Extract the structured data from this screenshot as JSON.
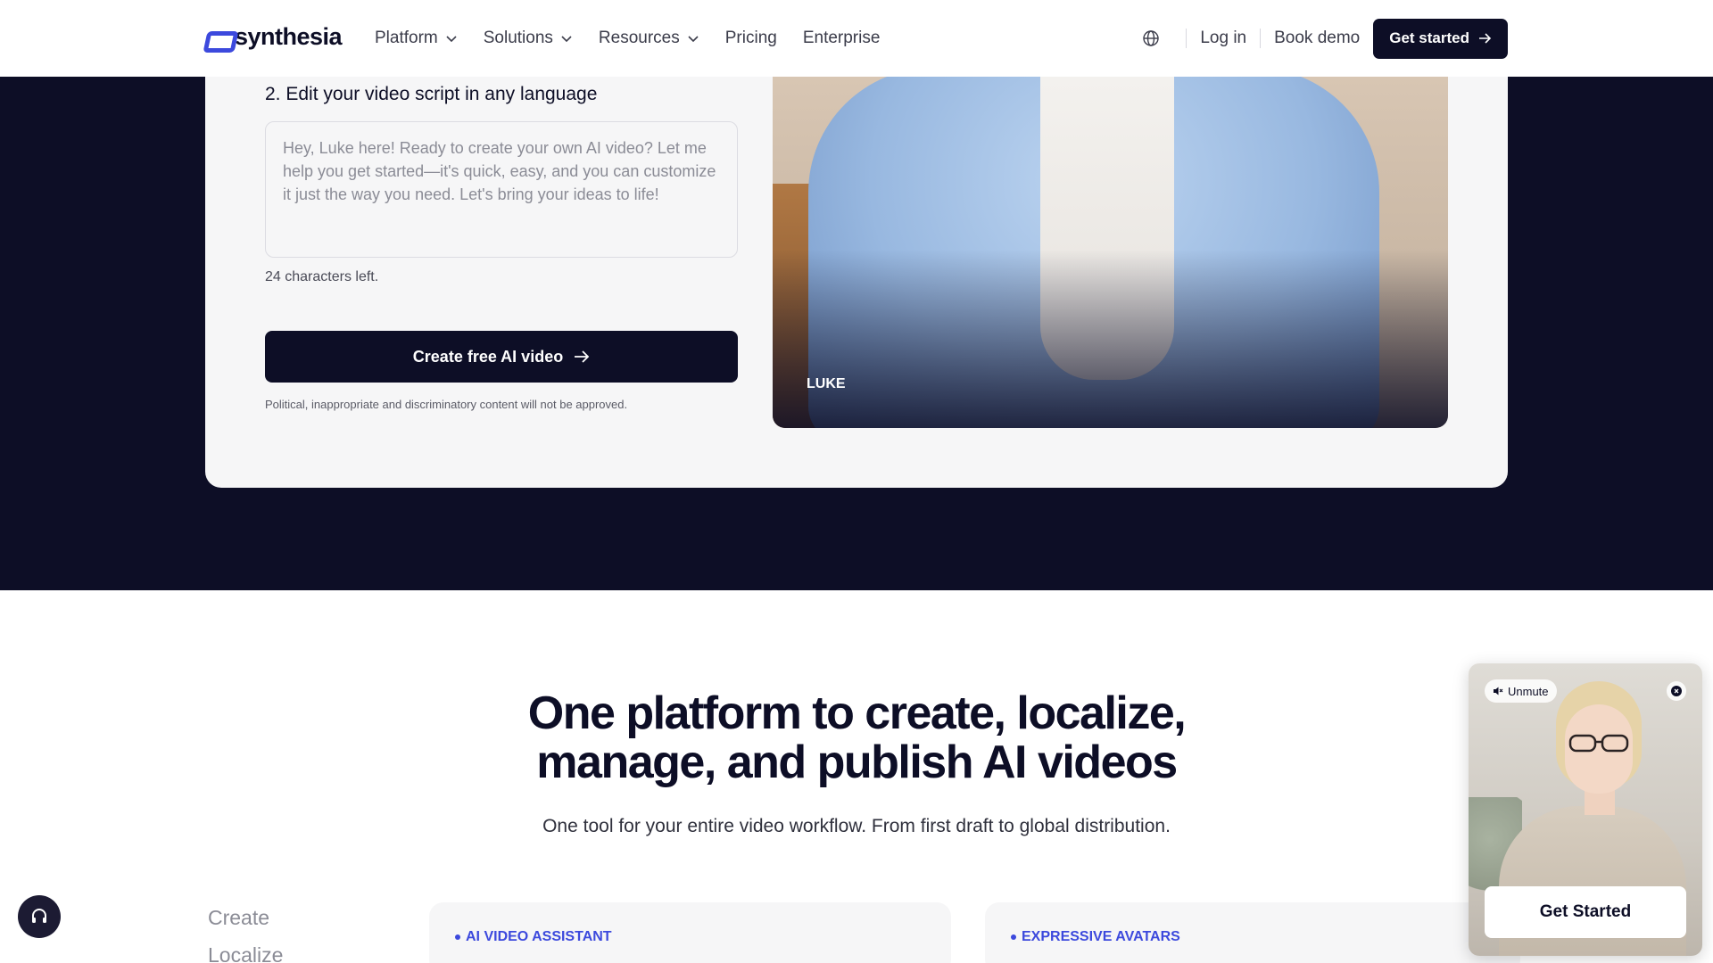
{
  "header": {
    "logo_text": "synthesia",
    "nav": [
      {
        "label": "Platform",
        "has_dropdown": true
      },
      {
        "label": "Solutions",
        "has_dropdown": true
      },
      {
        "label": "Resources",
        "has_dropdown": true
      },
      {
        "label": "Pricing",
        "has_dropdown": false
      },
      {
        "label": "Enterprise",
        "has_dropdown": false
      }
    ],
    "language_icon": "globe-icon",
    "login_label": "Log in",
    "book_demo_label": "Book demo",
    "get_started_label": "Get started"
  },
  "demo": {
    "step_title": "2. Edit your video script in any language",
    "script_text": "Hey, Luke here! Ready to create your own AI video? Let me help you get started—it's quick, easy, and you can customize it just the way you need. Let's bring your ideas to life!",
    "chars_left": "24 characters left.",
    "create_button_label": "Create free AI video",
    "disclaimer": "Political, inappropriate and discriminatory content will not be approved.",
    "avatar_name": "LUKE"
  },
  "platform": {
    "title_line1": "One platform to create, localize,",
    "title_line2": "manage, and publish AI videos",
    "subtitle": "One tool for your entire video workflow. From first draft to global distribution.",
    "tabs": [
      "Create",
      "Localize"
    ],
    "cards": [
      {
        "tag": "AI VIDEO ASSISTANT"
      },
      {
        "tag": "EXPRESSIVE AVATARS"
      }
    ]
  },
  "widget": {
    "unmute_label": "Unmute",
    "cta_label": "Get Started"
  },
  "colors": {
    "brand_dark": "#0d0e26",
    "accent_blue": "#3c49dd",
    "card_bg": "#f6f6f7"
  }
}
